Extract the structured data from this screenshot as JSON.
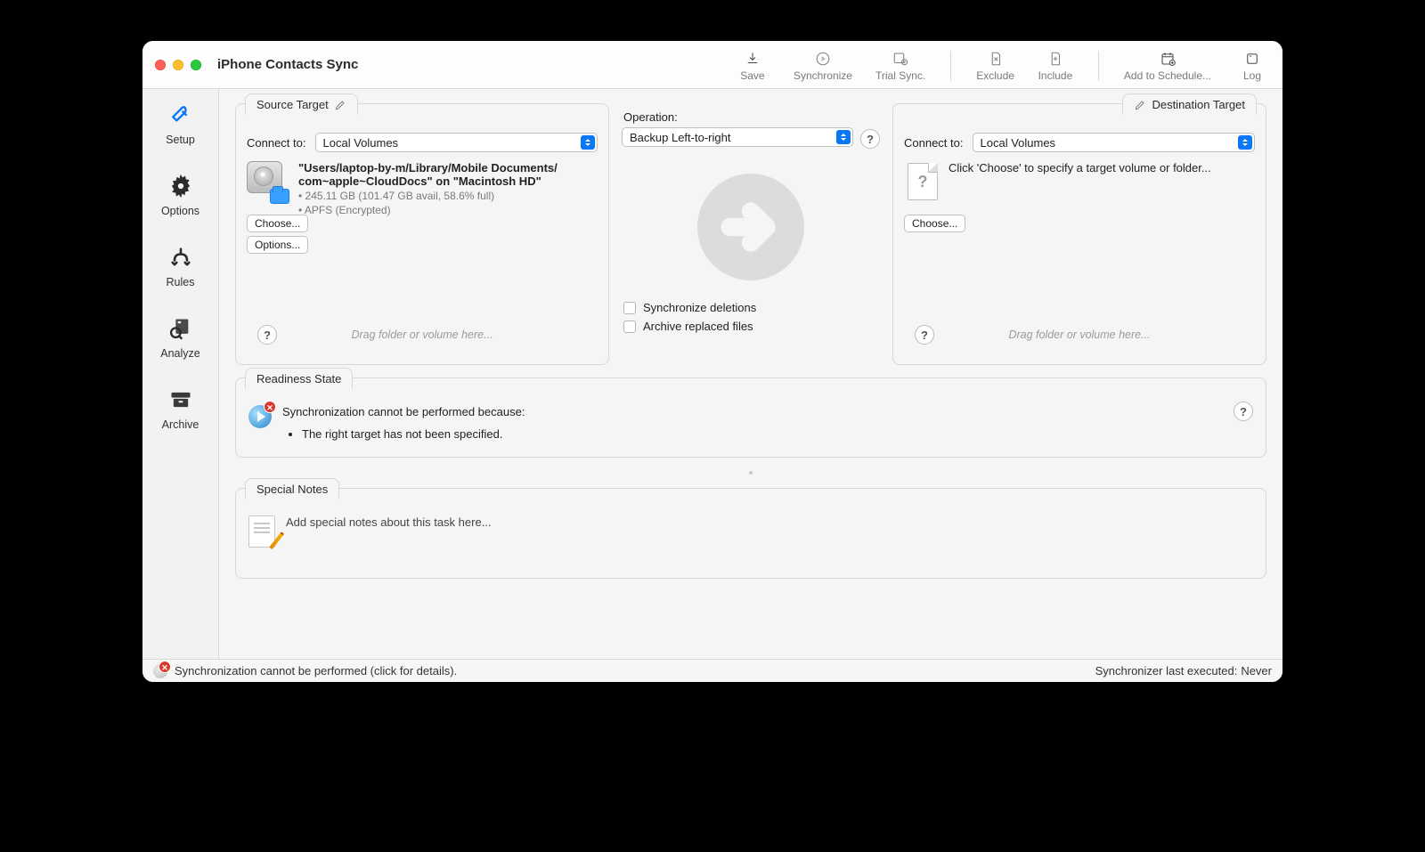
{
  "window": {
    "title": "iPhone Contacts Sync"
  },
  "toolbar": {
    "save": {
      "label": "Save",
      "enabled": true
    },
    "synchronize": {
      "label": "Synchronize",
      "enabled": false
    },
    "trial": {
      "label": "Trial Sync.",
      "enabled": false
    },
    "exclude": {
      "label": "Exclude",
      "enabled": false
    },
    "include": {
      "label": "Include",
      "enabled": false
    },
    "schedule": {
      "label": "Add to Schedule...",
      "enabled": true
    },
    "log": {
      "label": "Log",
      "enabled": true
    }
  },
  "sidebar": {
    "items": [
      {
        "id": "setup",
        "label": "Setup"
      },
      {
        "id": "options",
        "label": "Options"
      },
      {
        "id": "rules",
        "label": "Rules"
      },
      {
        "id": "analyze",
        "label": "Analyze"
      },
      {
        "id": "archive",
        "label": "Archive"
      }
    ]
  },
  "source": {
    "tab_label": "Source Target",
    "connect_label": "Connect to:",
    "connect_value": "Local Volumes",
    "path_line1": "\"Users/laptop-by-m/Library/Mobile Documents/",
    "path_line2": "com~apple~CloudDocs\" on \"Macintosh HD\"",
    "capacity": "• 245.11 GB (101.47 GB avail, 58.6% full)",
    "fs": "• APFS (Encrypted)",
    "choose_btn": "Choose...",
    "options_btn": "Options...",
    "drop_hint": "Drag folder or volume here..."
  },
  "operation": {
    "label": "Operation:",
    "value": "Backup Left-to-right",
    "sync_deletions_label": "Synchronize deletions",
    "archive_replaced_label": "Archive replaced files"
  },
  "destination": {
    "tab_label": "Destination Target",
    "connect_label": "Connect to:",
    "connect_value": "Local Volumes",
    "placeholder": "Click 'Choose' to specify a target volume or folder...",
    "choose_btn": "Choose...",
    "drop_hint": "Drag folder or volume here..."
  },
  "readiness": {
    "tab_label": "Readiness State",
    "message": "Synchronization cannot be performed because:",
    "reasons": [
      "The right target has not been specified."
    ]
  },
  "notes": {
    "tab_label": "Special Notes",
    "placeholder": "Add special notes about this task here..."
  },
  "statusbar": {
    "message": "Synchronization cannot be performed (click for details).",
    "last_exec_label": "Synchronizer last executed:",
    "last_exec_value": "Never"
  }
}
